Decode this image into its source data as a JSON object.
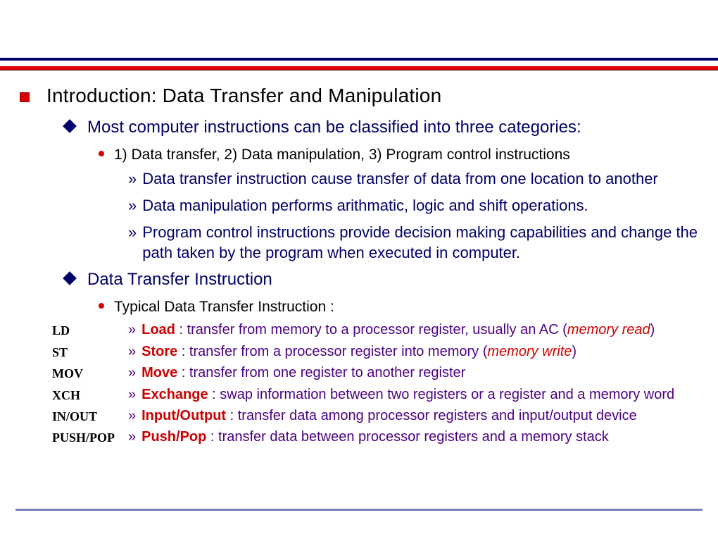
{
  "slide": {
    "title": "Introduction:  Data Transfer and Manipulation",
    "sec1": {
      "heading": "Most computer instructions can be classified into three categories:",
      "sub1": "1) Data transfer, 2) Data manipulation, 3) Program control instructions",
      "p1": "Data transfer instruction cause transfer of data from one location to another",
      "p2": "Data manipulation performs arithmatic, logic and shift operations.",
      "p3": "Program control instructions provide decision making capabilities and change the path taken by the program when executed in computer."
    },
    "sec2": {
      "heading": "Data Transfer Instruction",
      "sub1": "Typical Data Transfer Instruction :",
      "instr": [
        {
          "mnemonic": "LD",
          "kw": "Load",
          "body": " : transfer from memory to a processor register, usually an AC (",
          "tail_it": "memory read",
          "tail_end": ")"
        },
        {
          "mnemonic": "ST",
          "kw": "Store",
          "body": " : transfer from a processor register into memory (",
          "tail_it": "memory write",
          "tail_end": ")"
        },
        {
          "mnemonic": "MOV",
          "kw": "Move",
          "body": " : transfer from one register to another register",
          "tail_it": "",
          "tail_end": ""
        },
        {
          "mnemonic": "XCH",
          "kw": "Exchange",
          "body": " : swap information between two registers or a register and a memory word",
          "tail_it": "",
          "tail_end": ""
        },
        {
          "mnemonic": "IN/OUT",
          "kw": "Input/Output",
          "body": " : transfer data among processor registers and input/output device",
          "tail_it": "",
          "tail_end": ""
        },
        {
          "mnemonic": "PUSH/POP",
          "kw": "Push/Pop",
          "body": " : transfer data between processor registers and a memory stack",
          "tail_it": "",
          "tail_end": ""
        }
      ]
    }
  }
}
